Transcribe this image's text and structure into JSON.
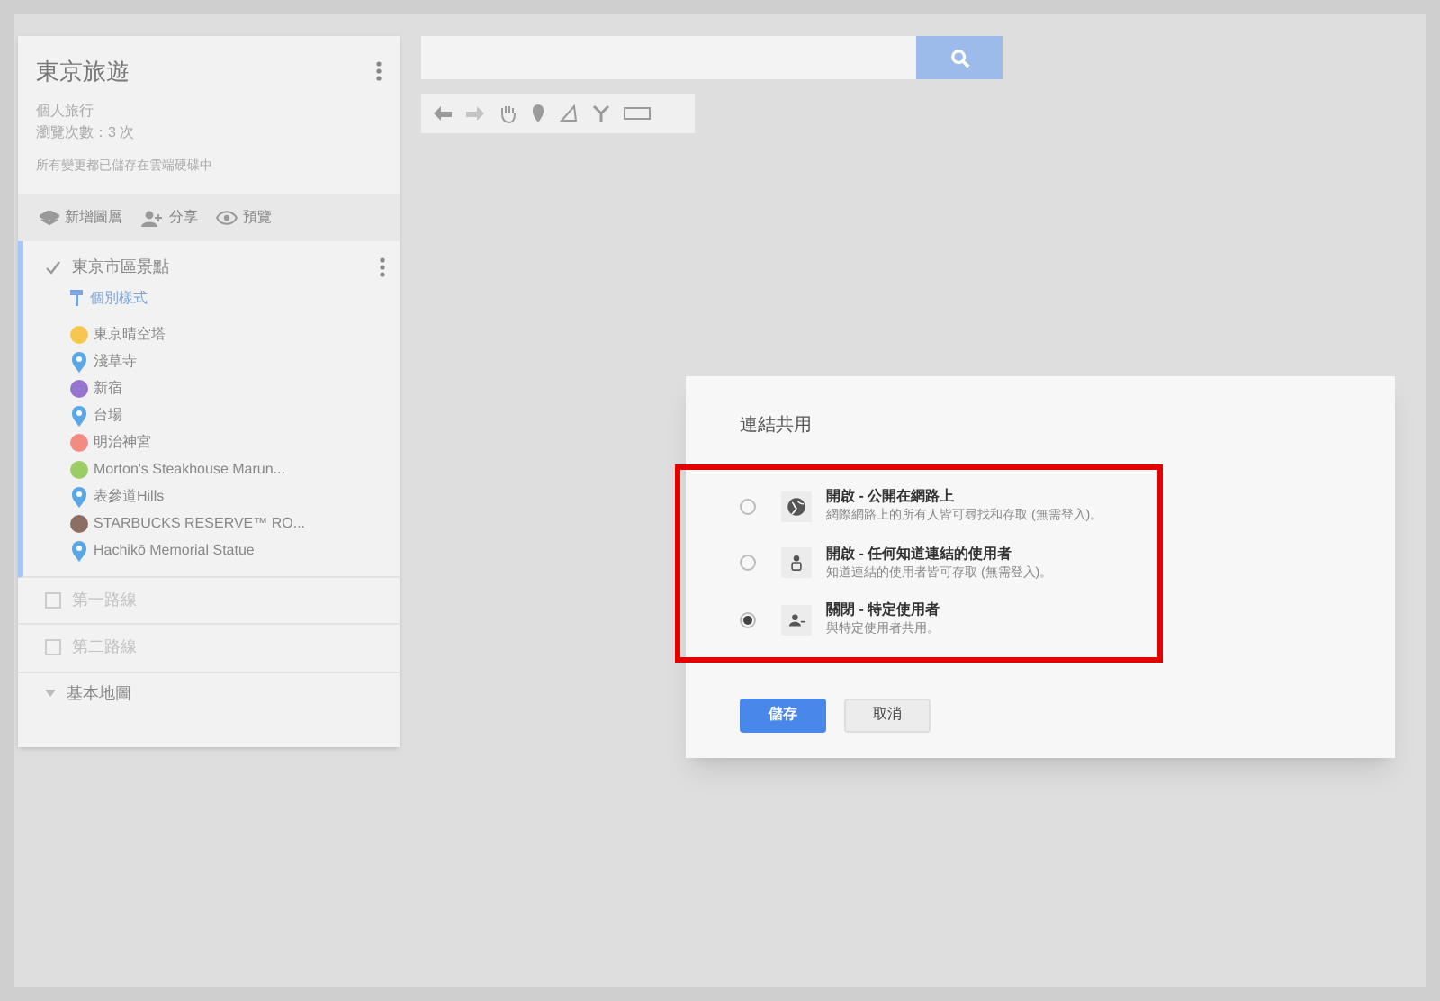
{
  "map_panel": {
    "title": "東京旅遊",
    "subtitle": "個人旅行",
    "views": "瀏覽次數：3 次",
    "save_status": "所有變更都已儲存在雲端硬碟中",
    "actions": [
      {
        "kind": "layers",
        "label": "新增圖層"
      },
      {
        "kind": "share",
        "label": "分享"
      },
      {
        "kind": "preview",
        "label": "預覽"
      }
    ],
    "layers": [
      {
        "name": "東京市區景點",
        "checked": true,
        "style_link": "個別樣式",
        "places": [
          {
            "name": "東京晴空塔",
            "kind": "circle",
            "color": "#f6c64e"
          },
          {
            "name": "淺草寺",
            "kind": "pin",
            "color": "#5aa7e6"
          },
          {
            "name": "新宿",
            "kind": "circle",
            "color": "#9575cd"
          },
          {
            "name": "台場",
            "kind": "pin",
            "color": "#5aa7e6"
          },
          {
            "name": "明治神宮",
            "kind": "circle",
            "color": "#f28b82"
          },
          {
            "name": "Morton's Steakhouse Marun...",
            "kind": "circle",
            "color": "#9ccc65"
          },
          {
            "name": "表參道Hills",
            "kind": "pin",
            "color": "#5aa7e6"
          },
          {
            "name": "STARBUCKS RESERVE™ RO...",
            "kind": "circle",
            "color": "#8d6e63"
          },
          {
            "name": "Hachikō Memorial Statue",
            "kind": "pin",
            "color": "#5aa7e6"
          }
        ]
      },
      {
        "name": "第一路線",
        "checked": false
      },
      {
        "name": "第二路線",
        "checked": false
      }
    ],
    "base_map": "基本地圖"
  },
  "dialog": {
    "title": "連結共用",
    "options": [
      {
        "kind": "public",
        "title": "開啟 - 公開在網路上",
        "description": "網際網路上的所有人皆可尋找和存取 (無需登入)。",
        "selected": false
      },
      {
        "kind": "link",
        "title": "開啟 - 任何知道連結的使用者",
        "description": "知道連結的使用者皆可存取 (無需登入)。",
        "selected": false
      },
      {
        "kind": "specific",
        "title": "關閉 - 特定使用者",
        "description": "與特定使用者共用。",
        "selected": true
      }
    ],
    "buttons": [
      {
        "kind": "primary",
        "label": "儲存"
      },
      {
        "kind": "secondary",
        "label": "取消"
      }
    ]
  }
}
